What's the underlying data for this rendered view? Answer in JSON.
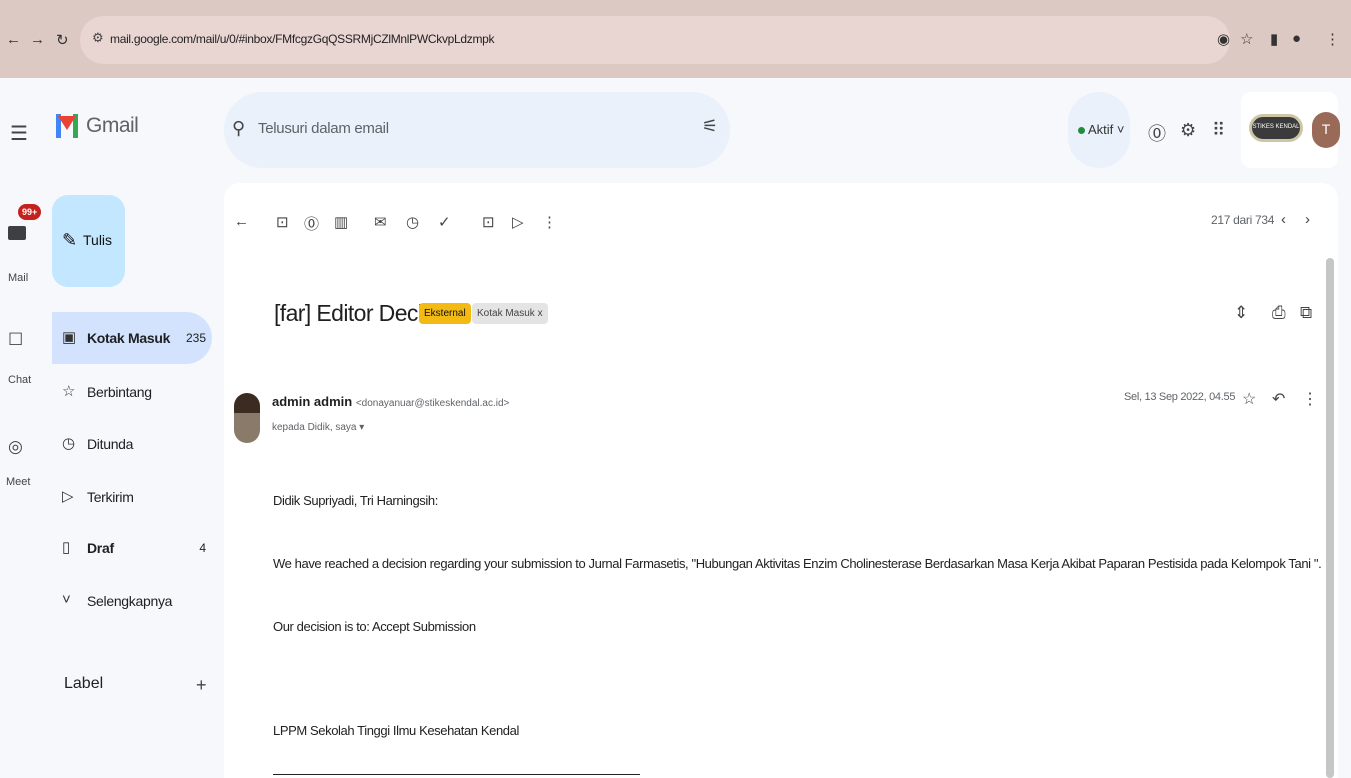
{
  "browser": {
    "url": "mail.google.com/mail/u/0/#inbox/FMfcgzGqQSSRMjCZlMnlPWCkvpLdzmpk"
  },
  "gmail": {
    "app_name": "Gmail",
    "search_placeholder": "Telusuri dalam email",
    "status": "Aktif ˅",
    "rail": {
      "mail_badge": "99+",
      "mail_label": "Mail",
      "chat_label": "Chat",
      "meet_label": "Meet"
    },
    "compose_label": "Tulis",
    "nav": [
      {
        "label": "Kotak Masuk",
        "count": "235"
      },
      {
        "label": "Berbintang",
        "count": ""
      },
      {
        "label": "Ditunda",
        "count": ""
      },
      {
        "label": "Terkirim",
        "count": ""
      },
      {
        "label": "Draf",
        "count": "4"
      },
      {
        "label": "Selengkapnya",
        "count": ""
      }
    ],
    "label_section": "Label",
    "account_org": "STIKES KENDAL",
    "account_initial": "T"
  },
  "message": {
    "pager": "217 dari 734",
    "subject": "[far] Editor Decision",
    "chip_external": "Eksternal",
    "chip_inbox": "Kotak Masuk x",
    "sender_name": "admin admin",
    "sender_email": "<donayanuar@stikeskendal.ac.id>",
    "recipients": "kepada Didik, saya ▾",
    "date": "Sel, 13 Sep 2022, 04.55",
    "body": {
      "greeting": "Didik Supriyadi, Tri Harningsih:",
      "line1": "We have reached a decision regarding your submission to Jurnal Farmasetis, \"Hubungan Aktivitas Enzim Cholinesterase Berdasarkan Masa Kerja Akibat Paparan Pestisida pada Kelompok Tani \".",
      "line2": "Our decision is to: Accept Submission",
      "signature": "LPPM Sekolah Tinggi Ilmu Kesehatan Kendal"
    }
  }
}
